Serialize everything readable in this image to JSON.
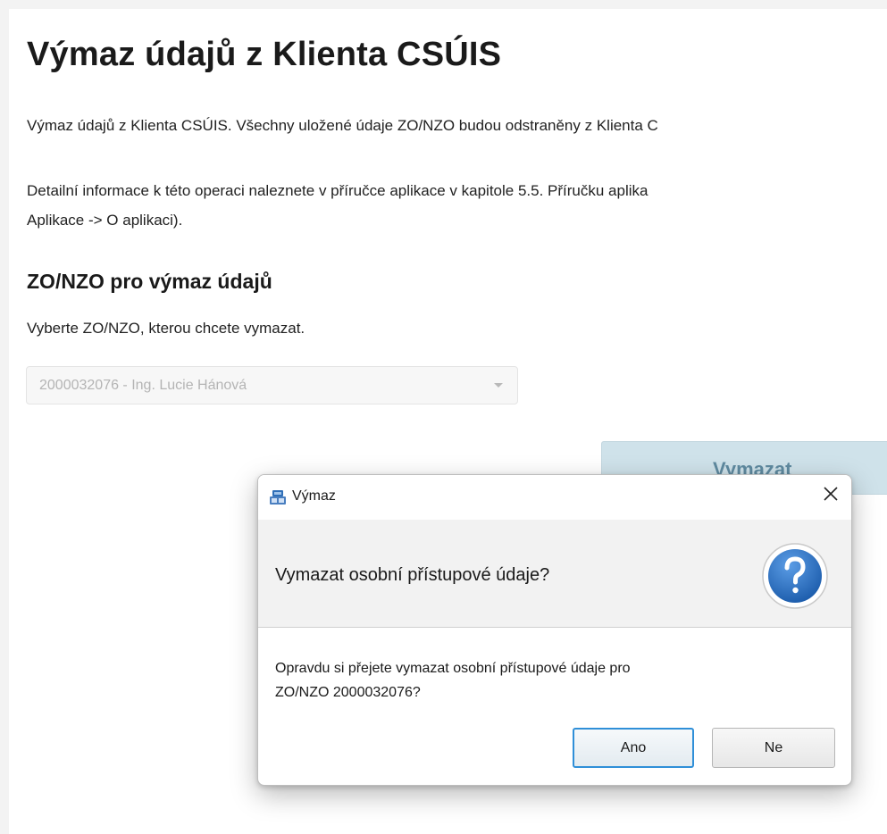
{
  "page": {
    "title": "Výmaz údajů z Klienta CSÚIS",
    "intro": "Výmaz údajů z Klienta CSÚIS. Všechny uložené údaje ZO/NZO budou odstraněny z Klienta C",
    "detail_line1": "Detailní informace k této operaci naleznete v příručce aplikace v kapitole 5.5. Příručku aplika",
    "detail_line2": "Aplikace -> O aplikaci).",
    "section_title": "ZO/NZO pro výmaz údajů",
    "hint": "Vyberte ZO/NZO, kterou chcete vymazat.",
    "select_value": "2000032076 - Ing. Lucie Hánová",
    "delete_button_label": "Vymazat"
  },
  "dialog": {
    "title": "Výmaz",
    "question": "Vymazat osobní přístupové údaje?",
    "message_line1": "Opravdu si přejete vymazat osobní přístupové údaje pro",
    "message_line2": "ZO/NZO 2000032076?",
    "yes_label": "Ano",
    "no_label": "Ne"
  },
  "icons": {
    "app": "app-icon",
    "close": "close-icon",
    "question": "question-icon",
    "dropdown": "chevron-down-icon"
  },
  "colors": {
    "accent": "#2f8fd8",
    "question_icon": "#2a6fc4",
    "disabled_button": "#cfe2ea"
  }
}
